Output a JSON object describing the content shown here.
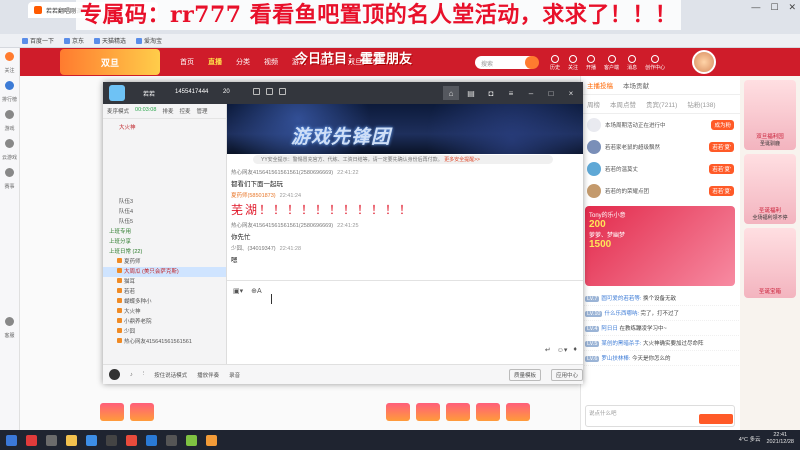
{
  "browser": {
    "tab_title": "若若翻唱刚调...",
    "banner": "专属码：rr777 看看鱼吧置顶的名人堂活动，求求了！！！",
    "bookmarks": [
      "百度一下",
      "京东",
      "天猫精选",
      "爱淘宝"
    ]
  },
  "side_nav": [
    "关注",
    "排行榜",
    "游戏",
    "云游戏",
    "赛事",
    "客服"
  ],
  "topnav": {
    "festival": "今日节目：霍霍朋友",
    "items": [
      "首页",
      "直播",
      "分类",
      "视频",
      "游戏",
      "鱼吧",
      "双旦福利园"
    ],
    "active_index": 1,
    "search_placeholder": "搜索",
    "user_icons": [
      "历史",
      "关注",
      "开播",
      "客户端",
      "消息",
      "创作中心"
    ]
  },
  "app": {
    "room_name": "若若",
    "room_id": "1455417444",
    "online": "20",
    "mode_label": "麦序模式",
    "mode_time": "00:03:08",
    "mode_actions": [
      "排麦",
      "控麦",
      "管理"
    ],
    "channels": [
      {
        "label": "大火神",
        "type": "host"
      },
      {
        "label": "队伍3",
        "type": "sub"
      },
      {
        "label": "队伍4",
        "type": "sub"
      },
      {
        "label": "队伍5",
        "type": "sub"
      },
      {
        "label": "上班专用",
        "type": "cat"
      },
      {
        "label": "上班分享",
        "type": "cat"
      },
      {
        "label": "上班日常 (22)",
        "type": "cat"
      },
      {
        "label": "夏药师",
        "type": "user"
      },
      {
        "label": "大周瓜 (美只会萨克斯)",
        "type": "user-hl"
      },
      {
        "label": "猫耳",
        "type": "user"
      },
      {
        "label": "若若",
        "type": "user"
      },
      {
        "label": "蝴蝶多种小",
        "type": "user"
      },
      {
        "label": "大火神",
        "type": "user"
      },
      {
        "label": "小鼎养老院",
        "type": "user"
      },
      {
        "label": "少囧",
        "type": "user"
      },
      {
        "label": "热心网友415641561561561",
        "type": "user"
      }
    ],
    "video_title": "游戏先锋团",
    "notice": "YY安全提示：警惕冒充官方、代练、工资日结等，请一定要先确认身份后再付款。",
    "notice_link": "更多安全提醒>>",
    "messages": [
      {
        "name": "热心网友415641561561561(2580696669)",
        "time": "22:41:22",
        "text": "都看们下面一起玩",
        "style": "normal"
      },
      {
        "name": "夏药师(58501873)",
        "time": "22:41:24",
        "text": "芜湖！！！！！！！！！！！",
        "style": "big"
      },
      {
        "name": "热心网友415641561561561(2580696669)",
        "time": "22:41:25",
        "text": "你先忙",
        "style": "normal"
      },
      {
        "name": "少囧、(34019347)",
        "time": "22:41:28",
        "text": "嗯",
        "style": "normal"
      }
    ],
    "footer": {
      "item1": "按住说话模式",
      "item2": "播放伴奏",
      "item3": "录音",
      "btn1": "质量模板",
      "btn2": "应用中心"
    }
  },
  "right_panel": {
    "tabs": [
      "主播投稿",
      "本场贡献"
    ],
    "tabs2": [
      "周榜",
      "本周点赞",
      "贵宾(7211)",
      "钻粉(138)"
    ],
    "ranks": [
      {
        "name": "本场周期活动正在进行中",
        "tag": "成为粉"
      },
      {
        "name": "若若家老鼠的超级飘然",
        "tag": "若若'夏'"
      },
      {
        "name": "若若的温莫丈",
        "tag": "若若'夏'"
      },
      {
        "name": "若若的的荣耀点团",
        "tag": "若若'夏'"
      }
    ],
    "gift_banner": {
      "title": "Tony的乐小意",
      "sub": "萝萝、梦幽梦",
      "x1": "200",
      "x2": "1500"
    },
    "chat": [
      {
        "lv": "LV.7",
        "user": "圆可爱的若若等:",
        "text": "换个设备无敌"
      },
      {
        "lv": "LV.10",
        "user": "什么乐西哪呐:",
        "text": "完了，打不过了"
      },
      {
        "lv": "LV.4",
        "user": "阿日日",
        "text": "在教练蹦凌学习中~"
      },
      {
        "lv": "LV.5",
        "user": "某创的黑暗杀手:",
        "text": "大火神确实要加过尽命阵"
      },
      {
        "lv": "LV.6",
        "user": "罗山扶林棒:",
        "text": "今天是你怎么的"
      }
    ],
    "send_placeholder": "说点什么吧"
  },
  "promo": {
    "title": "双旦福利园",
    "items": [
      "圣诞驯鹿",
      "圣诞福利",
      "圣诞宝箱"
    ],
    "sub": "全场福利领不停"
  },
  "taskbar": {
    "temp": "4°C 多云",
    "time": "22:41",
    "date": "2021/12/28"
  }
}
